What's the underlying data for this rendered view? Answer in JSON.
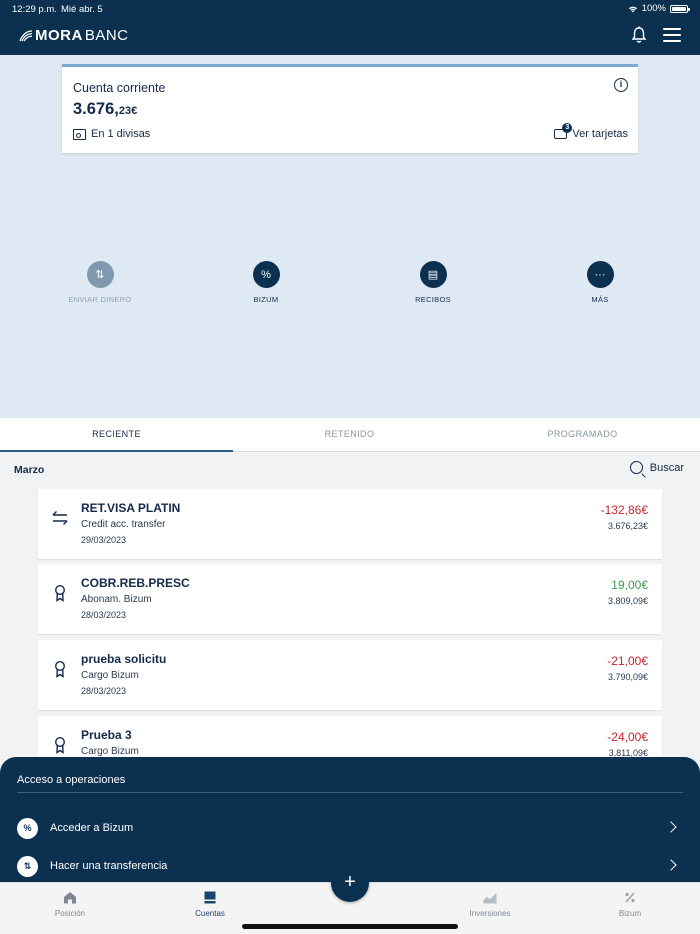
{
  "status_bar": {
    "time": "12:29 p.m.",
    "date": "Mié abr. 5",
    "battery": "100%"
  },
  "header": {
    "logo_bold": "MORA",
    "logo_light": "BANC"
  },
  "account": {
    "title": "Cuenta corriente",
    "amount_main": "3.676,",
    "amount_decimals": "23€",
    "currencies": "En 1 divisas",
    "cards_badge": "3",
    "cards_link": "Ver tarjetas"
  },
  "actions": [
    {
      "label": "ENVIAR DINERO",
      "glyph": "⇅"
    },
    {
      "label": "BIZUM",
      "glyph": "%"
    },
    {
      "label": "RECIBOS",
      "glyph": "▤"
    },
    {
      "label": "MÁS",
      "glyph": "···"
    }
  ],
  "tabs": [
    "RECIENTE",
    "RETENIDO",
    "PROGRAMADO"
  ],
  "list": {
    "month": "Marzo",
    "search_label": "Buscar",
    "transactions": [
      {
        "name": "RET.VISA PLATIN",
        "subtitle": "Credit acc. transfer",
        "date": "29/03/2023",
        "amount": "-132,86€",
        "balance": "3.676,23€",
        "icon": "transfer-icon"
      },
      {
        "name": "COBR.REB.PRESC",
        "subtitle": "Abonam. Bizum",
        "date": "28/03/2023",
        "amount": "19,00€",
        "balance": "3.809,09€",
        "icon": "award-icon"
      },
      {
        "name": "prueba solicitu",
        "subtitle": "Cargo Bizum",
        "date": "28/03/2023",
        "amount": "-21,00€",
        "balance": "3.790,09€",
        "icon": "award-icon"
      },
      {
        "name": "Prueba 3",
        "subtitle": "Cargo Bizum",
        "date": "",
        "amount": "-24,00€",
        "balance": "3.811,09€",
        "icon": "award-icon"
      }
    ]
  },
  "operations": {
    "title": "Acceso a operaciones",
    "items": [
      {
        "label": "Acceder a Bizum",
        "glyph": "%"
      },
      {
        "label": "Hacer una transferencia",
        "glyph": "⇅"
      }
    ]
  },
  "nav": {
    "items": [
      "Posición",
      "Cuentas",
      "Inversiones",
      "Bizum"
    ],
    "fab": "+"
  },
  "colors": {
    "primary": "#0c3150",
    "background": "#dfe9f3",
    "negative": "#c4242f",
    "positive": "#3a9a53"
  }
}
